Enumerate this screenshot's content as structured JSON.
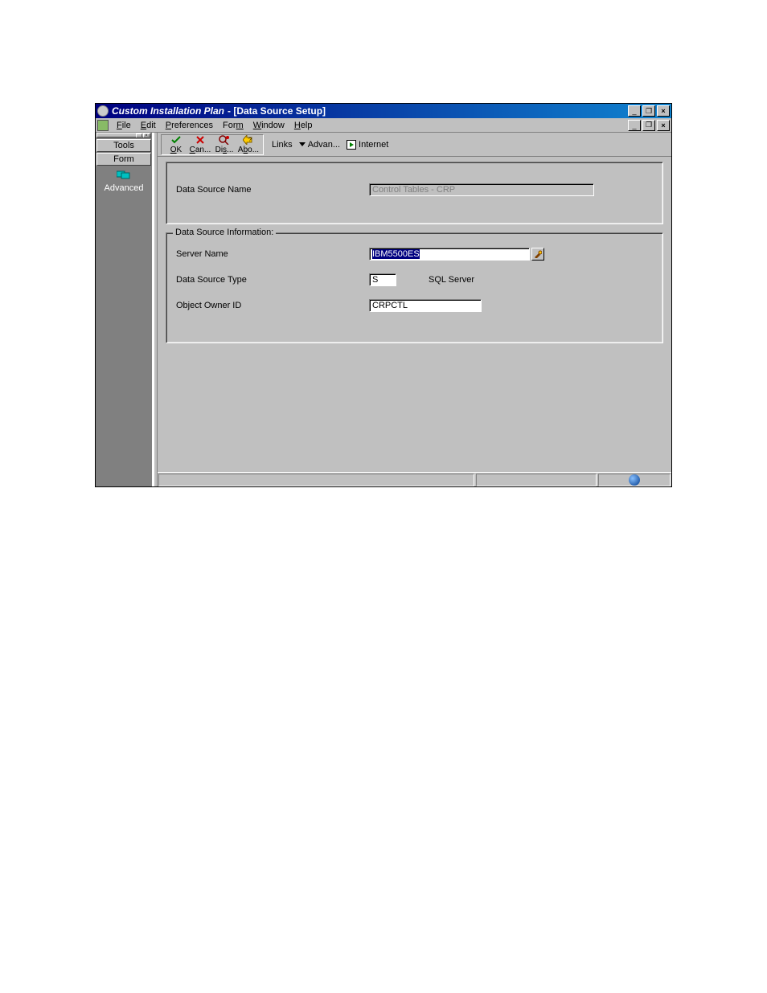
{
  "title": {
    "app": "Custom Installation Plan",
    "sub": " - [Data Source Setup]"
  },
  "menu": {
    "file": "File",
    "edit": "Edit",
    "preferences": "Preferences",
    "form": "Form",
    "window": "Window",
    "help": "Help"
  },
  "sidebar": {
    "tab_tools": "Tools",
    "tab_form": "Form",
    "advanced": "Advanced"
  },
  "toolbar": {
    "ok": "OK",
    "cancel": "Can...",
    "display": "Dis...",
    "about": "Abo...",
    "links": "Links",
    "advan": "Advan...",
    "internet": "Internet"
  },
  "form": {
    "data_source_name_label": "Data Source Name",
    "data_source_name_value": "Control Tables - CRP",
    "fieldset_legend": "Data Source Information:",
    "server_name_label": "Server Name",
    "server_name_value": "IBM5500ES",
    "data_source_type_label": "Data Source Type",
    "data_source_type_value": "S",
    "data_source_type_desc": "SQL Server",
    "object_owner_id_label": "Object Owner ID",
    "object_owner_id_value": "CRPCTL"
  }
}
